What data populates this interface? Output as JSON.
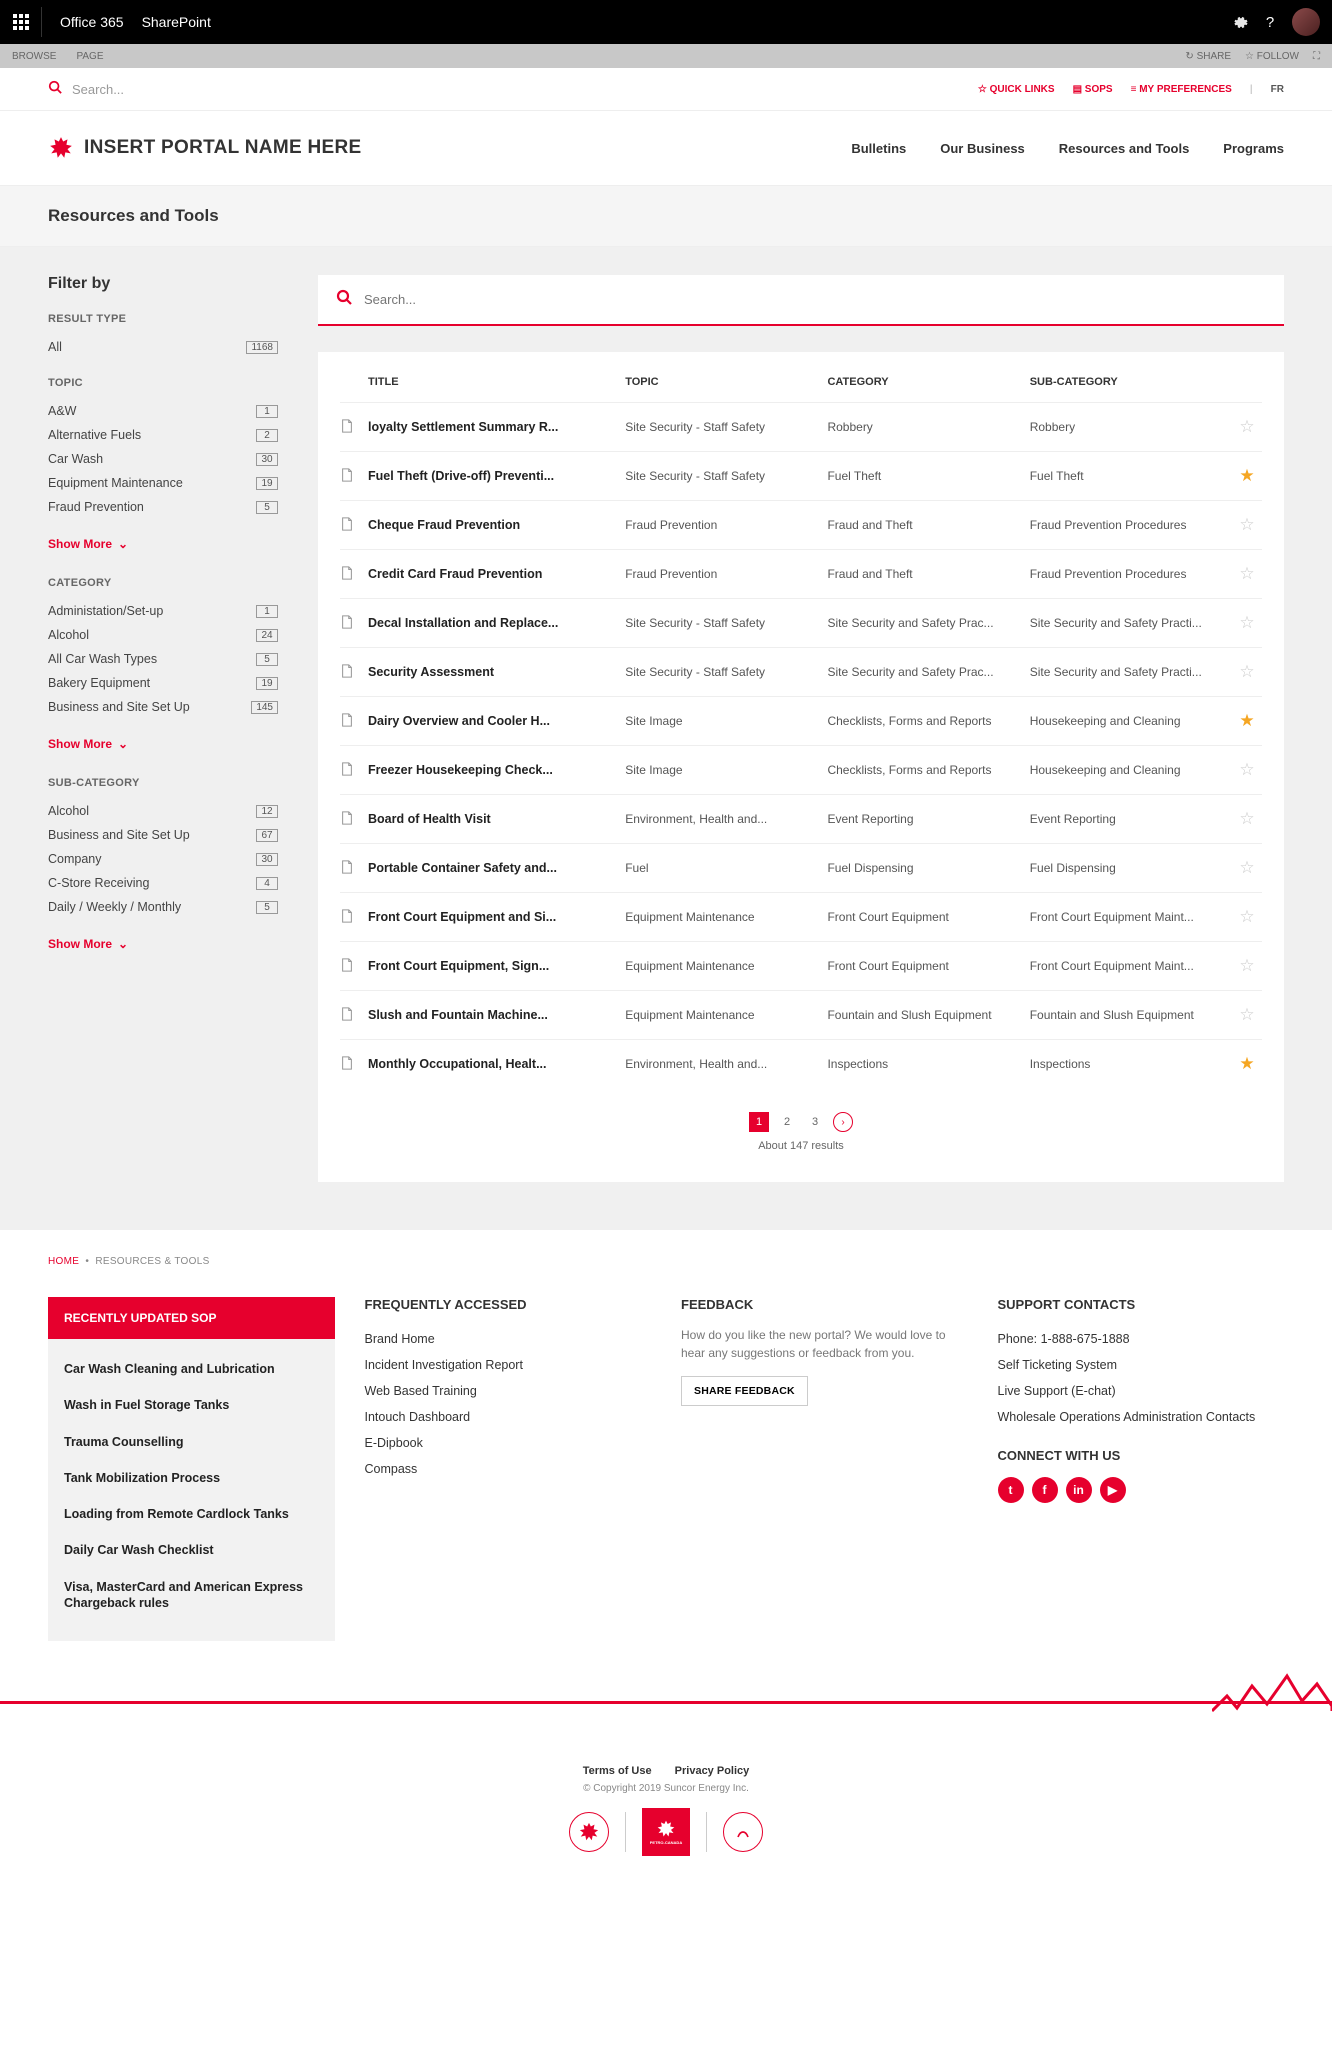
{
  "topbar": {
    "office": "Office 365",
    "sharepoint": "SharePoint"
  },
  "ribbon": {
    "browse": "BROWSE",
    "page": "PAGE",
    "share": "SHARE",
    "follow": "FOLLOW"
  },
  "util": {
    "search_placeholder": "Search...",
    "quicklinks": "QUICK LINKS",
    "sops": "SOPS",
    "prefs": "MY PREFERENCES",
    "lang": "FR"
  },
  "portal": {
    "title": "INSERT PORTAL NAME HERE",
    "nav": [
      "Bulletins",
      "Our Business",
      "Resources and Tools",
      "Programs"
    ]
  },
  "page_title": "Resources and Tools",
  "filter_title": "Filter by",
  "facets": {
    "result_type": {
      "heading": "RESULT TYPE",
      "items": [
        {
          "label": "All",
          "count": "1168"
        }
      ]
    },
    "topic": {
      "heading": "TOPIC",
      "items": [
        {
          "label": "A&W",
          "count": "1"
        },
        {
          "label": "Alternative Fuels",
          "count": "2"
        },
        {
          "label": "Car Wash",
          "count": "30"
        },
        {
          "label": "Equipment Maintenance",
          "count": "19"
        },
        {
          "label": "Fraud Prevention",
          "count": "5"
        }
      ]
    },
    "category": {
      "heading": "CATEGORY",
      "items": [
        {
          "label": "Administation/Set-up",
          "count": "1"
        },
        {
          "label": "Alcohol",
          "count": "24"
        },
        {
          "label": "All Car Wash Types",
          "count": "5"
        },
        {
          "label": "Bakery Equipment",
          "count": "19"
        },
        {
          "label": "Business and Site Set Up",
          "count": "145"
        }
      ]
    },
    "subcategory": {
      "heading": "SUB-CATEGORY",
      "items": [
        {
          "label": "Alcohol",
          "count": "12"
        },
        {
          "label": "Business and Site Set Up",
          "count": "67"
        },
        {
          "label": "Company",
          "count": "30"
        },
        {
          "label": "C-Store Receiving",
          "count": "4"
        },
        {
          "label": "Daily / Weekly / Monthly",
          "count": "5"
        }
      ]
    }
  },
  "show_more": "Show More",
  "content_search_placeholder": "Search...",
  "columns": {
    "title": "TITLE",
    "topic": "TOPIC",
    "category": "CATEGORY",
    "subcategory": "SUB-CATEGORY"
  },
  "rows": [
    {
      "title": "loyalty Settlement Summary R...",
      "topic": "Site Security - Staff Safety",
      "category": "Robbery",
      "sub": "Robbery",
      "fav": false
    },
    {
      "title": "Fuel Theft (Drive-off) Preventi...",
      "topic": "Site Security - Staff Safety",
      "category": "Fuel Theft",
      "sub": "Fuel Theft",
      "fav": true
    },
    {
      "title": "Cheque Fraud Prevention",
      "topic": "Fraud Prevention",
      "category": "Fraud and Theft",
      "sub": "Fraud Prevention Procedures",
      "fav": false
    },
    {
      "title": "Credit Card Fraud Prevention",
      "topic": "Fraud Prevention",
      "category": "Fraud and Theft",
      "sub": "Fraud Prevention Procedures",
      "fav": false
    },
    {
      "title": "Decal Installation and Replace...",
      "topic": "Site Security - Staff Safety",
      "category": "Site Security and Safety Prac...",
      "sub": "Site Security and Safety Practi...",
      "fav": false
    },
    {
      "title": "Security Assessment",
      "topic": "Site Security - Staff Safety",
      "category": "Site Security and Safety Prac...",
      "sub": "Site Security and Safety Practi...",
      "fav": false
    },
    {
      "title": "Dairy Overview and Cooler H...",
      "topic": "Site Image",
      "category": "Checklists, Forms and Reports",
      "sub": "Housekeeping and Cleaning",
      "fav": true
    },
    {
      "title": "Freezer Housekeeping Check...",
      "topic": "Site Image",
      "category": "Checklists, Forms and Reports",
      "sub": "Housekeeping and Cleaning",
      "fav": false
    },
    {
      "title": "Board of Health Visit",
      "topic": "Environment, Health and...",
      "category": "Event Reporting",
      "sub": "Event Reporting",
      "fav": false
    },
    {
      "title": "Portable Container Safety and...",
      "topic": "Fuel",
      "category": "Fuel Dispensing",
      "sub": "Fuel Dispensing",
      "fav": false
    },
    {
      "title": "Front Court Equipment and Si...",
      "topic": "Equipment Maintenance",
      "category": "Front Court Equipment",
      "sub": "Front Court Equipment Maint...",
      "fav": false
    },
    {
      "title": "Front Court Equipment, Sign...",
      "topic": "Equipment Maintenance",
      "category": "Front Court Equipment",
      "sub": "Front Court Equipment Maint...",
      "fav": false
    },
    {
      "title": "Slush and Fountain Machine...",
      "topic": "Equipment Maintenance",
      "category": "Fountain and Slush Equipment",
      "sub": "Fountain and Slush Equipment",
      "fav": false
    },
    {
      "title": "Monthly Occupational, Healt...",
      "topic": "Environment, Health and...",
      "category": "Inspections",
      "sub": "Inspections",
      "fav": true
    }
  ],
  "pager": {
    "pages": [
      "1",
      "2",
      "3"
    ],
    "results_text": "About 147 results"
  },
  "breadcrumb": {
    "home": "HOME",
    "current": "RESOURCES & TOOLS"
  },
  "recently": {
    "heading": "RECENTLY UPDATED SOP",
    "items": [
      "Car Wash Cleaning and Lubrication",
      "Wash in Fuel Storage Tanks",
      "Trauma Counselling",
      "Tank Mobilization Process",
      "Loading from Remote Cardlock Tanks",
      "Daily Car Wash Checklist",
      "Visa, MasterCard and American Express Chargeback rules"
    ]
  },
  "freq": {
    "heading": "FREQUENTLY ACCESSED",
    "items": [
      "Brand Home",
      "Incident Investigation Report",
      "Web Based Training",
      "Intouch Dashboard",
      "E-Dipbook",
      "Compass"
    ]
  },
  "feedback": {
    "heading": "FEEDBACK",
    "text": "How do you like the new portal? We would love to hear any suggestions or feedback from you.",
    "button": "SHARE FEEDBACK"
  },
  "support": {
    "heading": "SUPPORT CONTACTS",
    "items": [
      "Phone: 1-888-675-1888",
      "Self Ticketing System",
      "Live Support (E-chat)",
      "Wholesale Operations Administration Contacts"
    ]
  },
  "connect_heading": "CONNECT WITH US",
  "legal": {
    "terms": "Terms of Use",
    "privacy": "Privacy Policy",
    "copyright": "© Copyright 2019 Suncor Energy Inc."
  }
}
